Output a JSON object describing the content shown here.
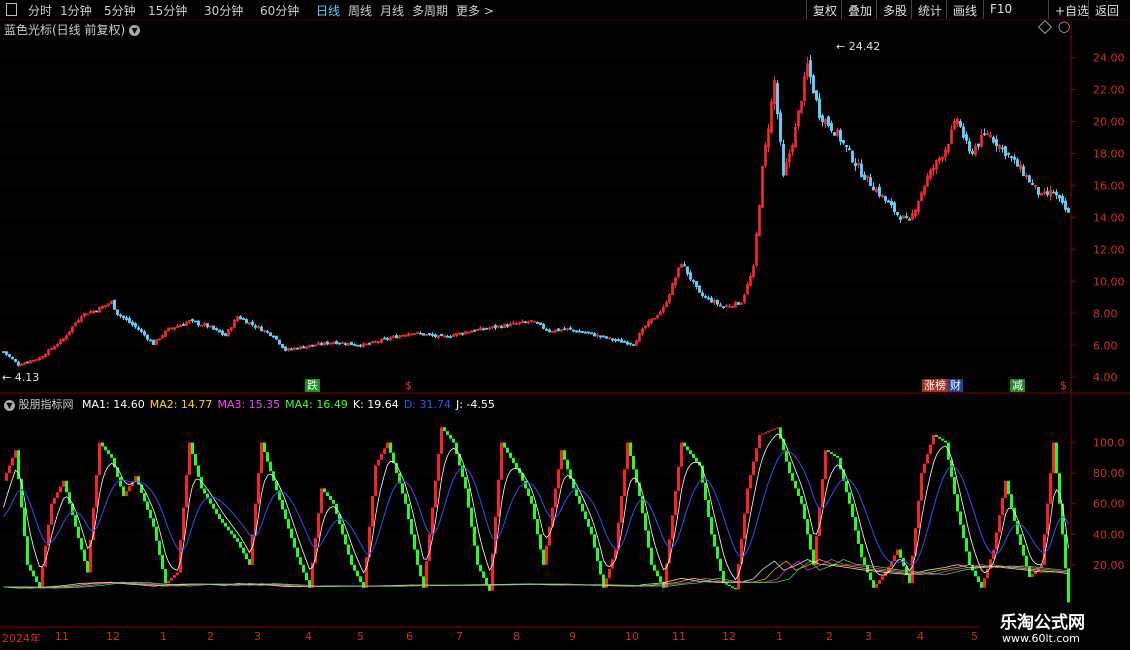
{
  "toolbar": {
    "periods": [
      "分时",
      "1分钟",
      "5分钟",
      "15分钟",
      "30分钟",
      "60分钟",
      "日线",
      "周线",
      "月线",
      "多周期",
      "更多"
    ],
    "active_index": 6,
    "more_arrow": ">",
    "right_buttons": [
      "复权",
      "叠加",
      "多股",
      "统计",
      "画线",
      "F10",
      "+自选",
      "返回"
    ]
  },
  "main_title": "蓝色光标(日线 前复权)",
  "indicator": {
    "name": "股朋指标网",
    "values": [
      {
        "label": "MA1: 14.60",
        "color": "#ffffff"
      },
      {
        "label": "MA2: 14.77",
        "color": "#ffd700"
      },
      {
        "label": "MA3: 15.35",
        "color": "#ff40ff"
      },
      {
        "label": "MA4: 16.49",
        "color": "#40ff40"
      },
      {
        "label": "K: 19.64",
        "color": "#ffffff"
      },
      {
        "label": "D: 31.74",
        "color": "#3050ff"
      },
      {
        "label": "J: -4.55",
        "color": "#ffffff"
      }
    ]
  },
  "markers": {
    "fall": "跌",
    "s1": "$",
    "zhangbang": "涨榜",
    "cai": "财",
    "jian": "减",
    "s2": "$"
  },
  "date_axis": [
    "2024年",
    "11",
    "12",
    "1",
    "2",
    "3",
    "4",
    "5",
    "6",
    "7",
    "8",
    "9",
    "10",
    "11",
    "12",
    "1",
    "2",
    "3",
    "4",
    "5"
  ],
  "watermark": {
    "title": "乐淘公式网",
    "url": "www.60lt.com"
  },
  "chart_data": [
    {
      "type": "candlestick",
      "price_labels": {
        "high": "24.42",
        "low": "4.13"
      },
      "y_ticks": [
        4.0,
        6.0,
        8.0,
        10.0,
        12.0,
        14.0,
        16.0,
        18.0,
        20.0,
        22.0,
        24.0
      ],
      "ylim": [
        3.2,
        25.6
      ],
      "close_keypoints": [
        [
          0,
          5.6
        ],
        [
          5,
          4.8
        ],
        [
          12,
          5.2
        ],
        [
          20,
          6.4
        ],
        [
          26,
          7.9
        ],
        [
          32,
          8.3
        ],
        [
          36,
          8.7
        ],
        [
          38,
          8.0
        ],
        [
          45,
          7.0
        ],
        [
          50,
          6.1
        ],
        [
          55,
          7.0
        ],
        [
          62,
          7.5
        ],
        [
          68,
          7.2
        ],
        [
          74,
          6.6
        ],
        [
          78,
          7.8
        ],
        [
          84,
          7.2
        ],
        [
          90,
          6.6
        ],
        [
          94,
          5.7
        ],
        [
          100,
          5.9
        ],
        [
          110,
          6.2
        ],
        [
          120,
          6.0
        ],
        [
          128,
          6.4
        ],
        [
          136,
          6.8
        ],
        [
          146,
          6.5
        ],
        [
          156,
          6.9
        ],
        [
          166,
          7.2
        ],
        [
          176,
          7.5
        ],
        [
          182,
          6.9
        ],
        [
          188,
          7.0
        ],
        [
          196,
          6.7
        ],
        [
          204,
          6.3
        ],
        [
          210,
          6.1
        ],
        [
          214,
          7.2
        ],
        [
          220,
          8.3
        ],
        [
          226,
          11.2
        ],
        [
          232,
          9.2
        ],
        [
          240,
          8.4
        ],
        [
          246,
          8.7
        ],
        [
          250,
          10.8
        ],
        [
          253,
          17.0
        ],
        [
          257,
          22.5
        ],
        [
          260,
          16.5
        ],
        [
          264,
          19.5
        ],
        [
          268,
          23.5
        ],
        [
          272,
          20.5
        ],
        [
          278,
          19.2
        ],
        [
          286,
          16.8
        ],
        [
          292,
          15.5
        ],
        [
          298,
          14.2
        ],
        [
          302,
          13.7
        ],
        [
          308,
          16.5
        ],
        [
          314,
          18.3
        ],
        [
          318,
          20.2
        ],
        [
          322,
          18.0
        ],
        [
          328,
          19.3
        ],
        [
          334,
          18.1
        ],
        [
          340,
          16.8
        ],
        [
          346,
          15.3
        ],
        [
          350,
          15.6
        ],
        [
          355,
          14.2
        ]
      ],
      "n_bars": 356
    },
    {
      "type": "kdj",
      "series": [
        {
          "name": "K",
          "color": "#ffffff"
        },
        {
          "name": "D",
          "color": "#3050ff"
        },
        {
          "name": "J",
          "color": "#ffffff"
        }
      ],
      "y_ticks": [
        20.0,
        40.0,
        60.0,
        80.0,
        100.0
      ],
      "ylim": [
        -20,
        120
      ],
      "j_keypoints": [
        [
          0,
          75
        ],
        [
          4,
          95
        ],
        [
          8,
          20
        ],
        [
          12,
          5
        ],
        [
          16,
          60
        ],
        [
          20,
          75
        ],
        [
          26,
          30
        ],
        [
          28,
          15
        ],
        [
          32,
          100
        ],
        [
          36,
          90
        ],
        [
          40,
          65
        ],
        [
          44,
          78
        ],
        [
          50,
          45
        ],
        [
          54,
          8
        ],
        [
          58,
          15
        ],
        [
          62,
          100
        ],
        [
          66,
          70
        ],
        [
          72,
          50
        ],
        [
          78,
          35
        ],
        [
          82,
          20
        ],
        [
          86,
          100
        ],
        [
          90,
          75
        ],
        [
          98,
          25
        ],
        [
          102,
          5
        ],
        [
          106,
          70
        ],
        [
          110,
          60
        ],
        [
          116,
          20
        ],
        [
          120,
          5
        ],
        [
          124,
          85
        ],
        [
          128,
          100
        ],
        [
          134,
          60
        ],
        [
          138,
          20
        ],
        [
          140,
          5
        ],
        [
          146,
          110
        ],
        [
          150,
          100
        ],
        [
          154,
          70
        ],
        [
          158,
          20
        ],
        [
          162,
          3
        ],
        [
          166,
          100
        ],
        [
          172,
          80
        ],
        [
          176,
          60
        ],
        [
          180,
          20
        ],
        [
          186,
          95
        ],
        [
          190,
          70
        ],
        [
          196,
          40
        ],
        [
          200,
          5
        ],
        [
          204,
          30
        ],
        [
          208,
          100
        ],
        [
          212,
          65
        ],
        [
          216,
          20
        ],
        [
          220,
          5
        ],
        [
          226,
          100
        ],
        [
          232,
          85
        ],
        [
          236,
          40
        ],
        [
          240,
          8
        ],
        [
          244,
          4
        ],
        [
          248,
          70
        ],
        [
          252,
          105
        ],
        [
          258,
          110
        ],
        [
          262,
          80
        ],
        [
          266,
          60
        ],
        [
          270,
          20
        ],
        [
          274,
          95
        ],
        [
          278,
          90
        ],
        [
          282,
          60
        ],
        [
          286,
          25
        ],
        [
          290,
          5
        ],
        [
          294,
          15
        ],
        [
          298,
          30
        ],
        [
          302,
          8
        ],
        [
          306,
          80
        ],
        [
          310,
          105
        ],
        [
          314,
          100
        ],
        [
          318,
          55
        ],
        [
          322,
          20
        ],
        [
          326,
          5
        ],
        [
          330,
          30
        ],
        [
          334,
          75
        ],
        [
          338,
          40
        ],
        [
          342,
          12
        ],
        [
          346,
          20
        ],
        [
          350,
          100
        ],
        [
          353,
          40
        ],
        [
          355,
          -4.55
        ]
      ],
      "k_final": 19.64,
      "d_final": 31.74
    }
  ],
  "colors": {
    "up": "#ff2828",
    "down": "#5fd0ff",
    "kdj_up": "#ff2020",
    "kdj_down": "#20ff20",
    "axis": "#8b0000"
  }
}
